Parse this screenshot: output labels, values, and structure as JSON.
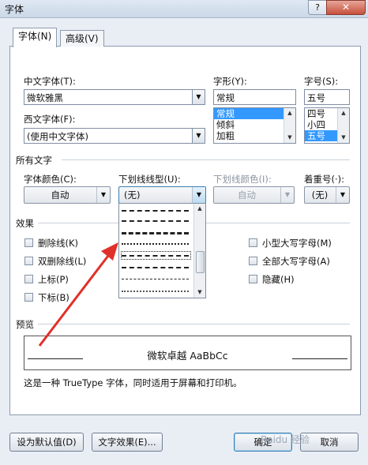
{
  "window": {
    "title": "字体",
    "help": "?",
    "close": "✕"
  },
  "tabs": [
    {
      "label": "字体(N)"
    },
    {
      "label": "高级(V)"
    }
  ],
  "font": {
    "chinese_label": "中文字体(T):",
    "chinese_value": "微软雅黑",
    "western_label": "西文字体(F):",
    "western_value": "(使用中文字体)",
    "style_label": "字形(Y):",
    "style_value": "常规",
    "style_options": [
      "常规",
      "倾斜",
      "加粗"
    ],
    "size_label": "字号(S):",
    "size_value": "五号",
    "size_options": [
      "四号",
      "小四",
      "五号"
    ]
  },
  "all_text": {
    "section_label": "所有文字",
    "color_label": "字体颜色(C):",
    "color_value": "自动",
    "underline_label": "下划线线型(U):",
    "underline_value": "(无)",
    "underline_color_label": "下划线颜色(I):",
    "underline_color_value": "自动",
    "emphasis_label": "着重号(·):",
    "emphasis_value": "(无)"
  },
  "effects": {
    "section_label": "效果",
    "left": [
      "删除线(K)",
      "双删除线(L)",
      "上标(P)",
      "下标(B)"
    ],
    "right": [
      "小型大写字母(M)",
      "全部大写字母(A)",
      "隐藏(H)"
    ]
  },
  "preview": {
    "section_label": "预览",
    "sample": "微软卓越  AaBbCc",
    "note": "这是一种 TrueType 字体，同时适用于屏幕和打印机。"
  },
  "buttons": {
    "set_default": "设为默认值(D)",
    "text_effects": "文字效果(E)...",
    "ok": "确定",
    "cancel": "取消"
  },
  "watermark": "Baidu 经验",
  "colors": {
    "selection": "#3399ff",
    "arrow": "#e0302a"
  }
}
